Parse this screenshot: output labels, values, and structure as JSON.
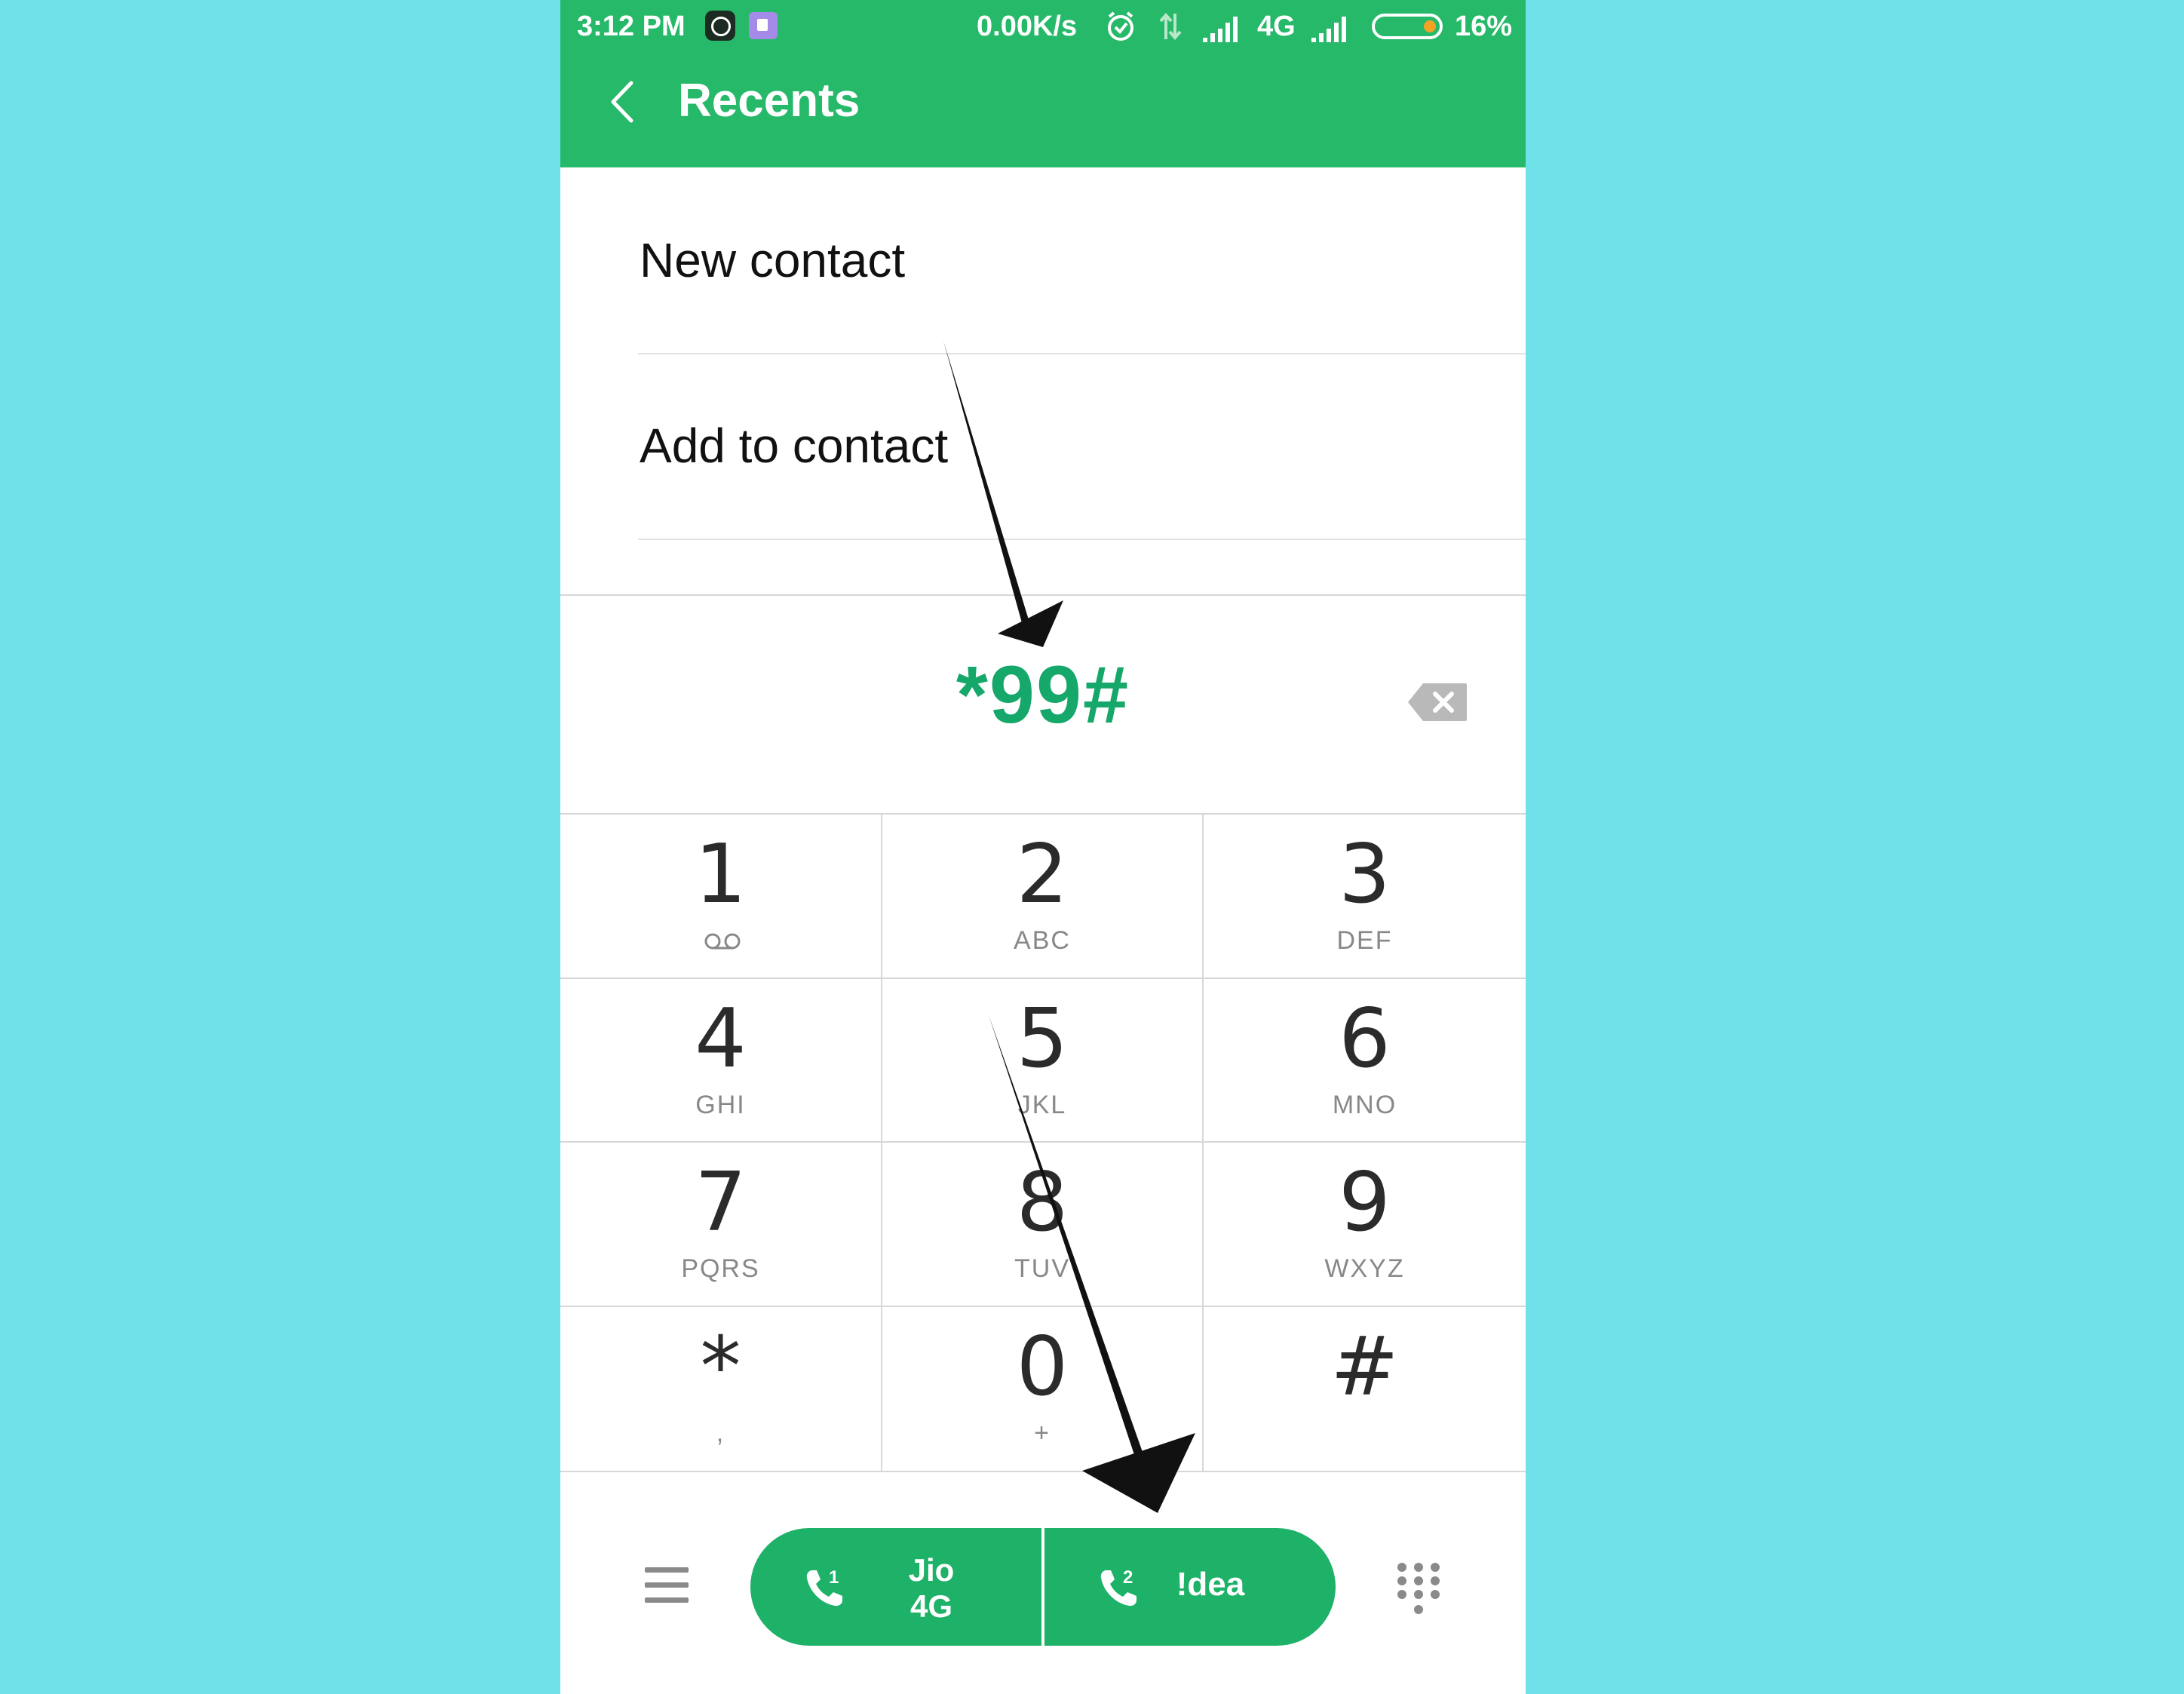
{
  "status_bar": {
    "time": "3:12 PM",
    "network_speed": "0.00K/s",
    "network_type": "4G",
    "battery": "16%"
  },
  "app_bar": {
    "title": "Recents"
  },
  "menu": {
    "new_contact": "New contact",
    "add_to_contact": "Add to contact"
  },
  "dialer": {
    "number": "*99#"
  },
  "keypad": [
    {
      "digit": "1",
      "letters": ""
    },
    {
      "digit": "2",
      "letters": "ABC"
    },
    {
      "digit": "3",
      "letters": "DEF"
    },
    {
      "digit": "4",
      "letters": "GHI"
    },
    {
      "digit": "5",
      "letters": "JKL"
    },
    {
      "digit": "6",
      "letters": "MNO"
    },
    {
      "digit": "7",
      "letters": "PQRS"
    },
    {
      "digit": "8",
      "letters": "TUV"
    },
    {
      "digit": "9",
      "letters": "WXYZ"
    },
    {
      "digit": "*",
      "letters": ","
    },
    {
      "digit": "0",
      "letters": "+"
    },
    {
      "digit": "#",
      "letters": ""
    }
  ],
  "call_buttons": {
    "sim1_number": "1",
    "sim1_label": "Jio 4G",
    "sim2_number": "2",
    "sim2_label": "!dea"
  },
  "colors": {
    "brand_green": "#27b96a",
    "call_green": "#1eb168",
    "number_green": "#16a76a",
    "background": "#6fe2e9"
  },
  "icons": {
    "back": "chevron-left-icon",
    "backspace": "backspace-icon",
    "voicemail": "voicemail-icon",
    "menu": "hamburger-menu-icon",
    "dialpad": "dialpad-grid-icon",
    "phone": "phone-icon"
  }
}
